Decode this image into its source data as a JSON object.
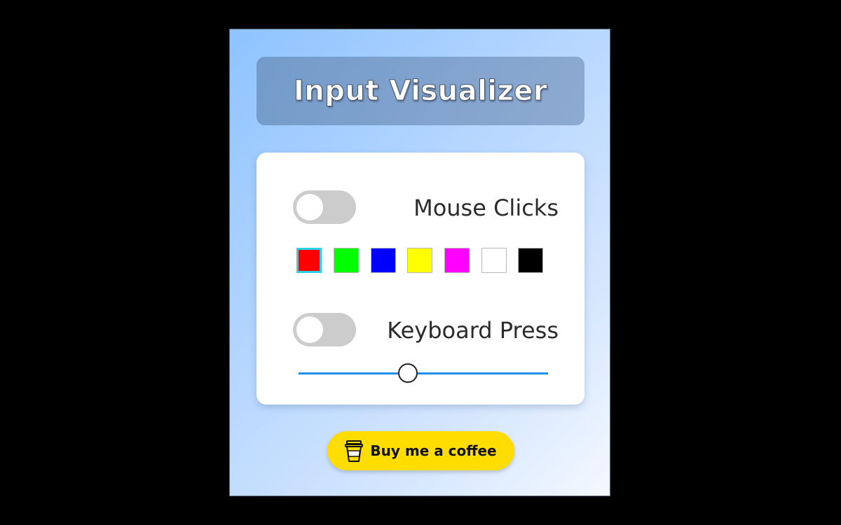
{
  "app": {
    "title": "Input Visualizer"
  },
  "mouse_clicks": {
    "label": "Mouse Clicks",
    "enabled": false
  },
  "color_swatches": [
    {
      "color": "#ff0000",
      "selected": true
    },
    {
      "color": "#00ff00",
      "selected": false
    },
    {
      "color": "#0000ff",
      "selected": false
    },
    {
      "color": "#ffff00",
      "selected": false
    },
    {
      "color": "#ff00ff",
      "selected": false
    },
    {
      "color": "#ffffff",
      "selected": false
    },
    {
      "color": "#000000",
      "selected": false
    }
  ],
  "keyboard_press": {
    "label": "Keyboard Press",
    "enabled": false
  },
  "slider": {
    "value_fraction": 0.44
  },
  "coffee_button": {
    "label": "Buy me a coffee",
    "icon": "coffee-cup-icon",
    "color": "#ffdd00"
  },
  "colors": {
    "selected_border": "#21d4e6",
    "slider_track": "#1e90e8",
    "toggle_off": "#cccccc"
  }
}
